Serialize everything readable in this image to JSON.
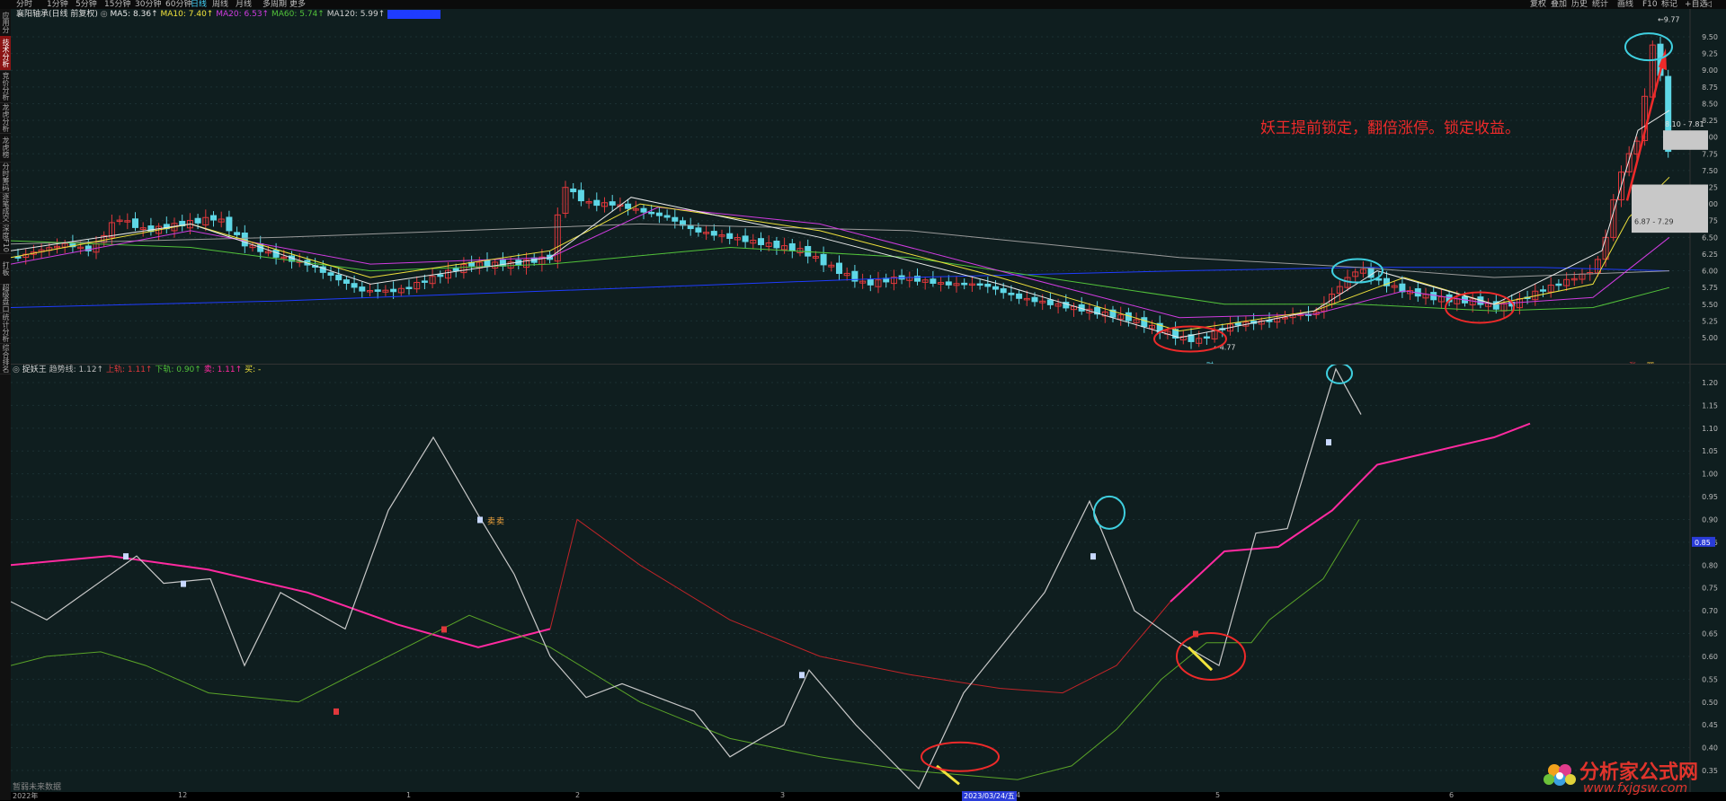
{
  "colors": {
    "up": "#e0383c",
    "down": "#5ed7e6",
    "ma5": "#e8e8e8",
    "ma10": "#f0e23c",
    "ma20": "#d03ce0",
    "ma60": "#52c23a",
    "ma120": "#9a9a9a",
    "ma250": "#1f3cff",
    "pink": "#ff2aa0",
    "annot": "#ee2a2a",
    "cyan": "#3fd0e0"
  },
  "topbar": {
    "items": [
      "分时",
      "1分钟",
      "5分钟",
      "15分钟",
      "30分钟",
      "60分钟",
      "日线",
      "周线",
      "月线",
      "多周期",
      "更多"
    ],
    "active": "日线",
    "right": [
      "复权",
      "叠加",
      "历史",
      "统计",
      "画线",
      "F10",
      "标记",
      "+自选",
      "◁"
    ]
  },
  "sidebar": [
    "应用分时",
    "技术分析",
    "竞价分析",
    "龙虎分析",
    "龙虎榜",
    "分时筹码",
    "逐笔成交",
    "深度F10",
    "打板",
    "超级盘口",
    "统计分析",
    "综合排名"
  ],
  "upper": {
    "stock": "襄阳轴承(日线 前复权)",
    "ma_legend": [
      "MA5: 8.36↑",
      "MA10: 7.40↑",
      "MA20: 6.53↑",
      "MA60: 5.74↑",
      "MA120: 5.99↑",
      "MA250: 5.9↑"
    ],
    "y_ticks": [
      "9.50",
      "9.25",
      "9.00",
      "8.75",
      "8.50",
      "8.25",
      "8.00",
      "7.75",
      "7.50",
      "7.25",
      "7.00",
      "6.75",
      "6.50",
      "6.25",
      "6.00",
      "5.75",
      "5.50",
      "5.25",
      "5.00"
    ],
    "price_high": "9.77",
    "price_low": "4.77",
    "range_upper": "8.10 - 7.81",
    "range_lower": "6.87 - 7.29",
    "cai": "财",
    "tags": [
      "张",
      "圆"
    ],
    "annotation": "妖王提前锁定，翻倍涨停。锁定收益。"
  },
  "lower": {
    "legend": {
      "name": "捉妖王",
      "trend": "趋势线: 1.12↑",
      "upper": "上轨: 1.11↑",
      "lower": "下轨: 0.90↑",
      "sell": "卖: 1.11↑",
      "buy": "买: -"
    },
    "y_ticks": [
      "1.20",
      "1.15",
      "1.10",
      "1.05",
      "1.00",
      "0.95",
      "0.90",
      "0.85",
      "0.80",
      "0.75",
      "0.70",
      "0.65",
      "0.60",
      "0.55",
      "0.50",
      "0.45",
      "0.40",
      "0.35"
    ],
    "current": "0.85",
    "note": "暂弱未来数据",
    "signal": "卖"
  },
  "xaxis": {
    "labels": [
      "2022年",
      "12",
      "1",
      "2",
      "3",
      "2023/03/24/五",
      "4",
      "5",
      "6"
    ]
  },
  "watermark": {
    "name": "分析家公式网",
    "url": "www.fxjgsw.com"
  },
  "chart_data": [
    {
      "type": "candlestick",
      "title": "襄阳轴承(日线 前复权)",
      "ylim": [
        4.77,
        9.77
      ],
      "series": [
        "MA5",
        "MA10",
        "MA20",
        "MA60",
        "MA120",
        "MA250"
      ],
      "annotations": [
        "9.77",
        "4.77",
        "8.10 - 7.81",
        "6.87 - 7.29",
        "妖王提前锁定，翻倍涨停。锁定收益。"
      ]
    },
    {
      "type": "line",
      "title": "捉妖王",
      "ylim": [
        0.33,
        1.22
      ],
      "series": [
        {
          "name": "趋势线",
          "values": [
            0.72,
            0.68,
            0.82,
            0.76,
            0.77,
            0.58,
            0.74,
            0.66,
            0.92,
            1.08,
            0.91,
            0.78,
            0.6,
            0.51,
            0.54,
            0.51,
            0.48,
            0.38,
            0.45,
            0.57,
            0.45,
            0.41,
            0.31,
            0.52,
            0.74,
            0.94,
            0.7,
            0.63,
            0.58,
            0.87,
            0.88,
            1.23,
            1.13
          ]
        },
        {
          "name": "上轨",
          "values": [
            0.8,
            0.82,
            0.79,
            0.74,
            0.67,
            0.62,
            0.66,
            0.9,
            0.8,
            0.68,
            0.6,
            0.56,
            0.53,
            0.52,
            0.58,
            0.72,
            0.83,
            0.84,
            0.92,
            1.02,
            1.08,
            1.11
          ]
        },
        {
          "name": "下轨",
          "values": [
            0.58,
            0.6,
            0.61,
            0.58,
            0.52,
            0.5,
            0.6,
            0.69,
            0.62,
            0.5,
            0.42,
            0.38,
            0.35,
            0.34,
            0.33,
            0.36,
            0.44,
            0.55,
            0.63,
            0.63,
            0.68,
            0.77,
            0.9
          ]
        }
      ]
    }
  ]
}
